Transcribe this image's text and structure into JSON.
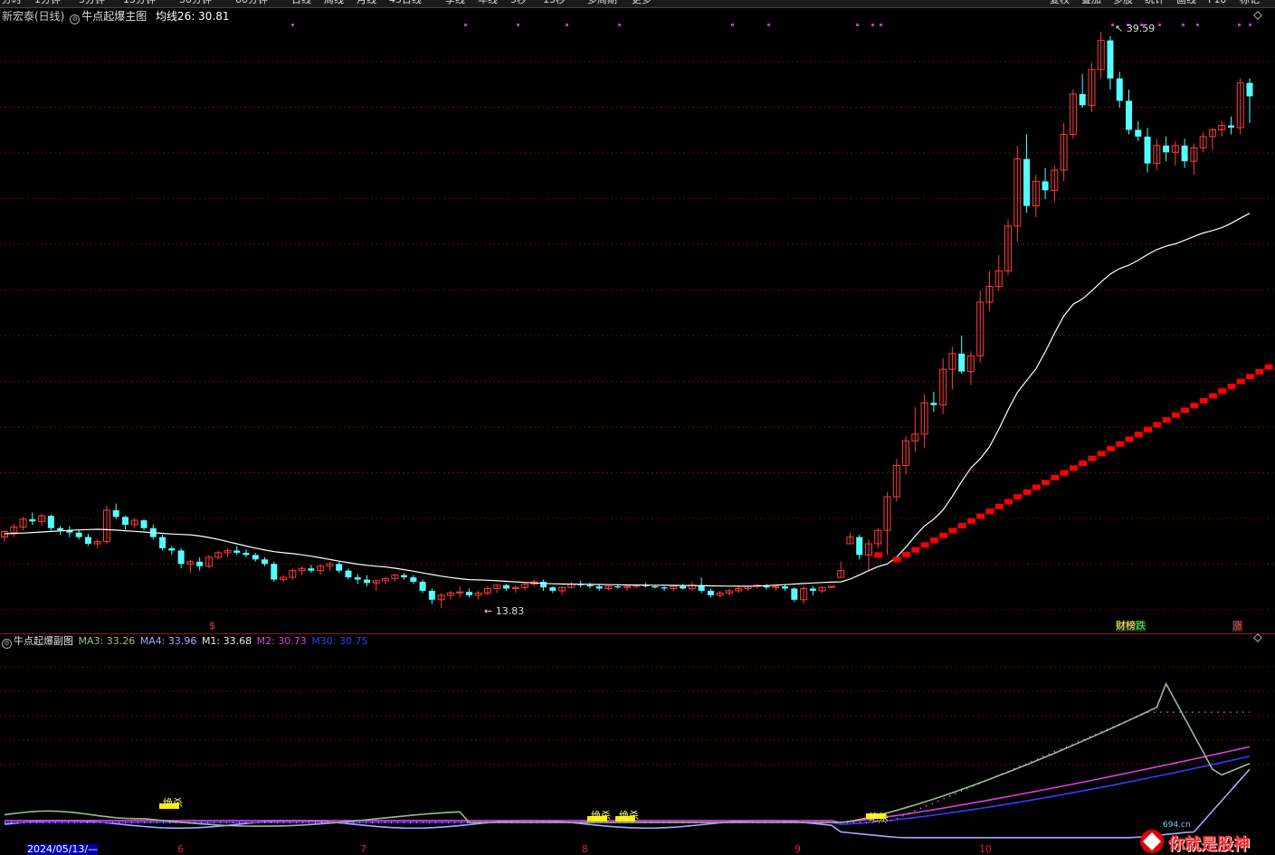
{
  "toolbar": {
    "items": [
      "分时",
      "1分钟",
      "5分钟",
      "15分钟",
      "30分钟",
      "60分钟",
      "日线",
      "周线",
      "月线",
      "45日线",
      "季线",
      "年线",
      "5秒",
      "15秒",
      "多周期",
      "更多"
    ],
    "right": [
      "复权",
      "叠加",
      "多股",
      "统计",
      "画线",
      "F10",
      "标记"
    ]
  },
  "main_header": {
    "stock": "新宏泰(日线)",
    "indicator": "牛点起爆主图",
    "ma_label": "均线26: 30.81"
  },
  "sub_header": {
    "indicator": "牛点起爆副图",
    "ma3": "MA3: 33.26",
    "ma4": "MA4: 33.96",
    "m1": "M1: 33.68",
    "m2": "M2: 30.73",
    "m30": "M30: 30.75"
  },
  "annotations": {
    "high": "39.59",
    "low": "13.83",
    "signal_s": "$",
    "tag_caibang": "财榜",
    "tag_die": "跌",
    "tag_zhang": "涨",
    "sub_labels": [
      "绝杀",
      "绝杀",
      "绝杀",
      "绝杀"
    ]
  },
  "date_axis": {
    "start": "2024/05/13/—",
    "months": [
      "6",
      "7",
      "8",
      "9",
      "10"
    ]
  },
  "watermark": {
    "text": "你就是股神",
    "site": "694.cn"
  },
  "colors": {
    "up": "#ff3c3c",
    "down": "#54ffff",
    "ma26": "#ffffff",
    "red_dots": "#ff0000",
    "m1": "#9fb98f",
    "m2": "#e23ee2",
    "m30": "#3a3aff",
    "ma4": "#a8a8ff"
  },
  "chart_data": {
    "type": "candlestick",
    "title": "新宏泰(日线)",
    "x_range": [
      "2024-05-13",
      "2024-10-16"
    ],
    "price_high": 39.59,
    "price_low": 13.83,
    "ma26_last": 30.81,
    "candles": [
      [
        17.0,
        17.3,
        16.8,
        17.25
      ],
      [
        17.2,
        17.6,
        17.0,
        17.45
      ],
      [
        17.45,
        17.9,
        17.3,
        17.8
      ],
      [
        17.8,
        18.1,
        17.55,
        17.7
      ],
      [
        17.7,
        18.05,
        17.5,
        17.95
      ],
      [
        17.95,
        18.0,
        17.3,
        17.4
      ],
      [
        17.4,
        17.5,
        17.1,
        17.3
      ],
      [
        17.3,
        17.5,
        17.0,
        17.2
      ],
      [
        17.2,
        17.3,
        16.9,
        17.0
      ],
      [
        17.0,
        17.15,
        16.6,
        16.7
      ],
      [
        16.7,
        16.9,
        16.5,
        16.8
      ],
      [
        16.8,
        18.4,
        16.7,
        18.2
      ],
      [
        18.2,
        18.5,
        17.8,
        17.9
      ],
      [
        17.9,
        17.95,
        17.35,
        17.55
      ],
      [
        17.55,
        17.85,
        17.4,
        17.75
      ],
      [
        17.75,
        17.8,
        17.3,
        17.4
      ],
      [
        17.4,
        17.55,
        16.9,
        17.0
      ],
      [
        17.0,
        17.1,
        16.4,
        16.5
      ],
      [
        16.5,
        16.6,
        16.2,
        16.4
      ],
      [
        16.4,
        16.5,
        15.6,
        15.8
      ],
      [
        15.8,
        16.0,
        15.4,
        15.9
      ],
      [
        15.9,
        16.1,
        15.5,
        15.7
      ],
      [
        15.7,
        16.2,
        15.6,
        16.1
      ],
      [
        16.1,
        16.4,
        16.0,
        16.3
      ],
      [
        16.3,
        16.5,
        16.1,
        16.4
      ],
      [
        16.4,
        16.6,
        16.2,
        16.3
      ],
      [
        16.3,
        16.45,
        16.1,
        16.2
      ],
      [
        16.2,
        16.3,
        15.9,
        16.0
      ],
      [
        16.0,
        16.1,
        15.7,
        15.8
      ],
      [
        15.8,
        15.9,
        15.0,
        15.1
      ],
      [
        15.1,
        15.3,
        15.0,
        15.2
      ],
      [
        15.2,
        15.6,
        15.1,
        15.5
      ],
      [
        15.5,
        15.7,
        15.3,
        15.6
      ],
      [
        15.6,
        15.75,
        15.4,
        15.5
      ],
      [
        15.5,
        15.8,
        15.3,
        15.7
      ],
      [
        15.7,
        15.9,
        15.5,
        15.8
      ],
      [
        15.8,
        15.9,
        15.4,
        15.5
      ],
      [
        15.5,
        15.6,
        15.1,
        15.2
      ],
      [
        15.2,
        15.35,
        14.9,
        15.1
      ],
      [
        15.1,
        15.3,
        14.8,
        14.95
      ],
      [
        14.95,
        15.1,
        14.6,
        15.05
      ],
      [
        15.05,
        15.2,
        14.9,
        15.15
      ],
      [
        15.15,
        15.35,
        15.0,
        15.3
      ],
      [
        15.3,
        15.4,
        15.1,
        15.2
      ],
      [
        15.2,
        15.3,
        14.9,
        15.0
      ],
      [
        15.0,
        15.1,
        14.5,
        14.6
      ],
      [
        14.6,
        14.7,
        14.0,
        14.2
      ],
      [
        14.2,
        14.5,
        13.83,
        14.4
      ],
      [
        14.4,
        14.6,
        14.2,
        14.5
      ],
      [
        14.5,
        14.8,
        14.3,
        14.55
      ],
      [
        14.55,
        14.7,
        14.3,
        14.4
      ],
      [
        14.4,
        14.6,
        14.2,
        14.5
      ],
      [
        14.5,
        14.8,
        14.4,
        14.7
      ],
      [
        14.7,
        14.9,
        14.5,
        14.85
      ],
      [
        14.85,
        14.9,
        14.6,
        14.7
      ],
      [
        14.7,
        14.85,
        14.5,
        14.75
      ],
      [
        14.75,
        14.95,
        14.6,
        14.9
      ],
      [
        14.9,
        15.1,
        14.8,
        15.0
      ],
      [
        15.0,
        15.1,
        14.6,
        14.75
      ],
      [
        14.75,
        14.8,
        14.5,
        14.6
      ],
      [
        14.6,
        14.8,
        14.4,
        14.75
      ],
      [
        14.75,
        15.0,
        14.7,
        14.9
      ],
      [
        14.9,
        15.05,
        14.75,
        14.85
      ],
      [
        14.85,
        14.95,
        14.7,
        14.8
      ],
      [
        14.8,
        14.9,
        14.6,
        14.7
      ],
      [
        14.7,
        14.85,
        14.6,
        14.8
      ],
      [
        14.8,
        14.9,
        14.7,
        14.75
      ],
      [
        14.75,
        14.85,
        14.6,
        14.8
      ],
      [
        14.8,
        14.9,
        14.7,
        14.85
      ],
      [
        14.85,
        14.95,
        14.75,
        14.8
      ],
      [
        14.8,
        14.85,
        14.7,
        14.75
      ],
      [
        14.75,
        14.8,
        14.6,
        14.7
      ],
      [
        14.7,
        14.85,
        14.6,
        14.8
      ],
      [
        14.8,
        14.9,
        14.65,
        14.7
      ],
      [
        14.7,
        15.0,
        14.6,
        14.85
      ],
      [
        14.85,
        15.2,
        14.5,
        14.6
      ],
      [
        14.6,
        14.7,
        14.3,
        14.4
      ],
      [
        14.4,
        14.6,
        14.3,
        14.5
      ],
      [
        14.5,
        14.7,
        14.4,
        14.6
      ],
      [
        14.6,
        14.8,
        14.5,
        14.7
      ],
      [
        14.7,
        14.85,
        14.6,
        14.8
      ],
      [
        14.8,
        14.9,
        14.7,
        14.85
      ],
      [
        14.85,
        14.9,
        14.65,
        14.75
      ],
      [
        14.75,
        14.85,
        14.6,
        14.8
      ],
      [
        14.8,
        14.9,
        14.6,
        14.7
      ],
      [
        14.7,
        14.75,
        14.1,
        14.2
      ],
      [
        14.2,
        14.8,
        14.0,
        14.7
      ],
      [
        14.7,
        14.8,
        14.4,
        14.6
      ],
      [
        14.6,
        14.8,
        14.5,
        14.75
      ],
      [
        14.75,
        14.8,
        14.75,
        14.8
      ],
      [
        15.2,
        15.9,
        15.2,
        15.5
      ],
      [
        16.7,
        17.2,
        16.7,
        17.0
      ],
      [
        17.0,
        17.1,
        16.0,
        16.2
      ],
      [
        16.2,
        16.9,
        15.5,
        16.7
      ],
      [
        16.7,
        17.4,
        16.5,
        17.3
      ],
      [
        17.3,
        19.0,
        16.2,
        18.8
      ],
      [
        18.8,
        20.5,
        18.6,
        20.2
      ],
      [
        20.2,
        21.5,
        19.8,
        21.3
      ],
      [
        21.3,
        22.8,
        20.8,
        21.6
      ],
      [
        21.6,
        23.4,
        21.0,
        23.0
      ],
      [
        23.0,
        23.5,
        22.6,
        22.9
      ],
      [
        22.9,
        25.0,
        22.5,
        24.5
      ],
      [
        24.5,
        25.5,
        23.6,
        25.2
      ],
      [
        25.2,
        26.0,
        24.3,
        24.4
      ],
      [
        24.4,
        25.3,
        23.8,
        25.1
      ],
      [
        25.1,
        28.0,
        24.8,
        27.5
      ],
      [
        27.5,
        28.9,
        27.1,
        28.2
      ],
      [
        28.2,
        29.6,
        28.0,
        28.9
      ],
      [
        28.9,
        31.2,
        28.7,
        30.9
      ],
      [
        30.9,
        34.5,
        30.2,
        33.9
      ],
      [
        33.9,
        35.0,
        31.5,
        31.8
      ],
      [
        31.8,
        33.2,
        31.3,
        32.9
      ],
      [
        32.9,
        33.5,
        32.1,
        32.5
      ],
      [
        32.5,
        33.6,
        32.0,
        33.4
      ],
      [
        33.4,
        35.5,
        32.9,
        35.0
      ],
      [
        35.0,
        37.0,
        34.8,
        36.8
      ],
      [
        36.8,
        37.7,
        36.2,
        36.3
      ],
      [
        36.3,
        38.2,
        36.0,
        37.9
      ],
      [
        37.9,
        39.59,
        37.5,
        39.2
      ],
      [
        39.2,
        39.4,
        37.0,
        37.5
      ],
      [
        37.5,
        37.8,
        36.2,
        36.5
      ],
      [
        36.5,
        37.0,
        35.0,
        35.2
      ],
      [
        35.2,
        35.6,
        34.7,
        34.9
      ],
      [
        34.9,
        35.3,
        33.3,
        33.7
      ],
      [
        33.7,
        34.8,
        33.4,
        34.5
      ],
      [
        34.5,
        34.9,
        33.8,
        34.2
      ],
      [
        34.2,
        34.7,
        33.6,
        34.5
      ],
      [
        34.5,
        34.8,
        33.5,
        33.8
      ],
      [
        33.8,
        34.6,
        33.2,
        34.4
      ],
      [
        34.4,
        35.1,
        34.2,
        34.9
      ],
      [
        34.9,
        35.3,
        34.3,
        35.2
      ],
      [
        35.2,
        35.6,
        34.9,
        35.4
      ],
      [
        35.4,
        35.8,
        35.0,
        35.3
      ],
      [
        35.3,
        37.5,
        35.0,
        37.3
      ],
      [
        37.3,
        37.5,
        35.5,
        36.7
      ]
    ],
    "ma26_anchor_points": [
      [
        0,
        17.15
      ],
      [
        10,
        17.35
      ],
      [
        20,
        17.1
      ],
      [
        30,
        16.3
      ],
      [
        40,
        15.7
      ],
      [
        50,
        15.1
      ],
      [
        60,
        14.9
      ],
      [
        70,
        14.85
      ],
      [
        80,
        14.8
      ],
      [
        90,
        15.0
      ],
      [
        95,
        15.8
      ],
      [
        100,
        17.8
      ],
      [
        105,
        20.5
      ],
      [
        110,
        24.0
      ],
      [
        115,
        27.4
      ],
      [
        120,
        29.0
      ],
      [
        125,
        30.0
      ],
      [
        130,
        30.7
      ],
      [
        136,
        31.8
      ]
    ],
    "red_trend_start": [
      96,
      16.0
    ],
    "red_trend_end": [
      136,
      24.6
    ]
  }
}
